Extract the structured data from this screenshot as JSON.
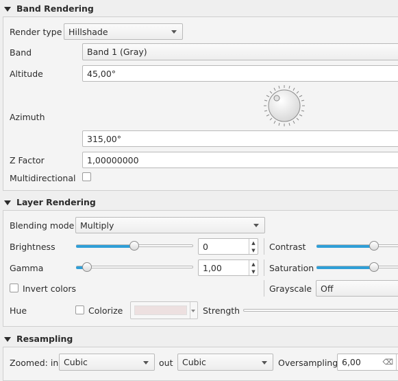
{
  "band_rendering": {
    "title": "Band Rendering",
    "render_type_label": "Render type",
    "render_type_value": "Hillshade",
    "band_label": "Band",
    "band_value": "Band 1 (Gray)",
    "altitude_label": "Altitude",
    "altitude_value": "45,00°",
    "azimuth_label": "Azimuth",
    "azimuth_value": "315,00°",
    "z_factor_label": "Z Factor",
    "z_factor_value": "1,00000000",
    "multidirectional_label": "Multidirectional",
    "multidirectional_checked": false
  },
  "layer_rendering": {
    "title": "Layer Rendering",
    "blending_mode_label": "Blending mode",
    "blending_mode_value": "Multiply",
    "brightness_label": "Brightness",
    "brightness_value": "0",
    "brightness_slider_level": 0.5,
    "contrast_label": "Contrast",
    "contrast_slider_level": 0.5,
    "gamma_label": "Gamma",
    "gamma_value": "1,00",
    "gamma_slider_level": 0.1,
    "saturation_label": "Saturation",
    "saturation_slider_level": 0.5,
    "invert_colors_label": "Invert colors",
    "grayscale_label": "Grayscale",
    "grayscale_value": "Off",
    "hue_label": "Hue",
    "colorize_label": "Colorize",
    "colorize_swatch": "#ede0e0",
    "strength_label": "Strength"
  },
  "resampling": {
    "title": "Resampling",
    "zoomed_in_label": "Zoomed: in",
    "zoomed_in_value": "Cubic",
    "zoomed_out_label": "out",
    "zoomed_out_value": "Cubic",
    "oversampling_label": "Oversampling",
    "oversampling_value": "6,00"
  },
  "colors": {
    "accent": "#2f9fd7"
  }
}
